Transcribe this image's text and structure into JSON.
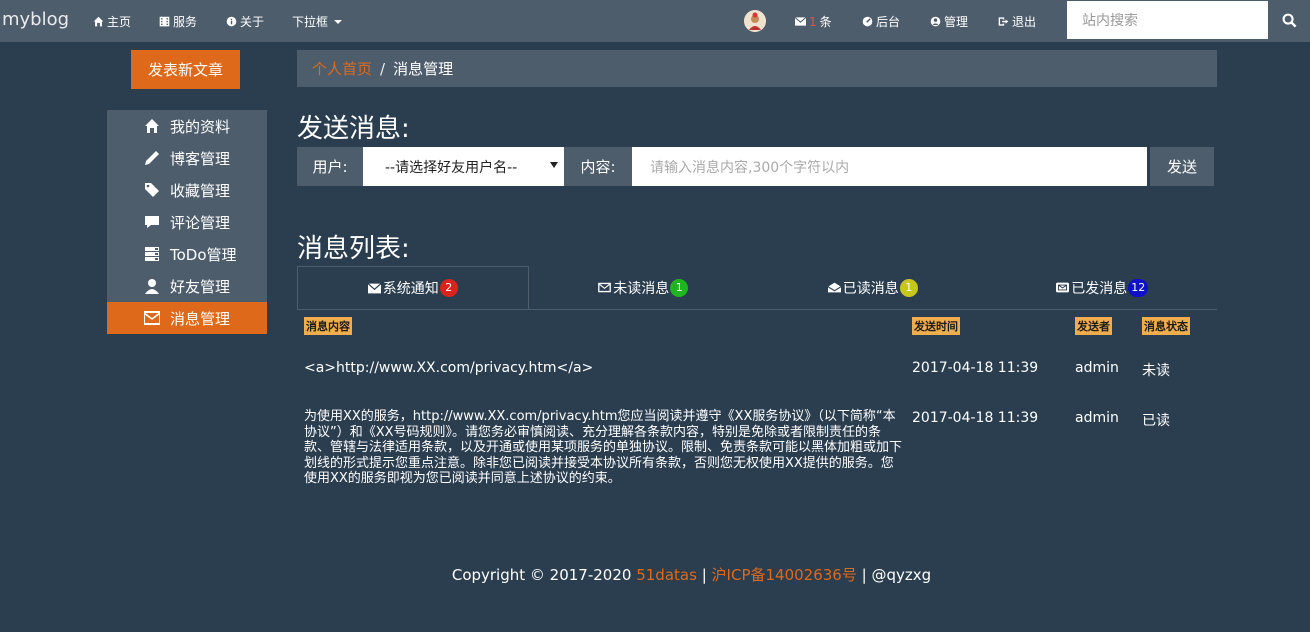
{
  "navbar": {
    "brand": "myblog",
    "items": [
      {
        "label": "主页",
        "icon": "home-icon"
      },
      {
        "label": "服务",
        "icon": "film-icon"
      },
      {
        "label": "关于",
        "icon": "info-icon"
      }
    ],
    "dropdown_label": "下拉框",
    "messages_count": "1",
    "messages_suffix": "条",
    "backend_label": "后台",
    "manage_label": "管理",
    "logout_label": "退出",
    "search_placeholder": "站内搜索"
  },
  "sidebar": {
    "new_post_label": "发表新文章",
    "items": [
      {
        "label": "我的资料",
        "icon": "home-icon"
      },
      {
        "label": "博客管理",
        "icon": "pencil-icon"
      },
      {
        "label": "收藏管理",
        "icon": "tags-icon"
      },
      {
        "label": "评论管理",
        "icon": "comment-icon"
      },
      {
        "label": "ToDo管理",
        "icon": "tasks-icon"
      },
      {
        "label": "好友管理",
        "icon": "user-icon"
      },
      {
        "label": "消息管理",
        "icon": "envelope-icon"
      }
    ]
  },
  "breadcrumb": {
    "home": "个人首页",
    "separator": "/",
    "current": "消息管理"
  },
  "send": {
    "title": "发送消息:",
    "user_label": "用户:",
    "user_select_value": "--请选择好友用户名--",
    "content_label": "内容:",
    "content_placeholder": "请输入消息内容,300个字符以内",
    "send_button": "发送"
  },
  "list": {
    "title": "消息列表:",
    "tabs": [
      {
        "label": "系统通知",
        "count": "2",
        "badge_color": "#d9231d"
      },
      {
        "label": "未读消息",
        "count": "1",
        "badge_color": "#1fb51f"
      },
      {
        "label": "已读消息",
        "count": "1",
        "badge_color": "#c7c71a"
      },
      {
        "label": "已发消息",
        "count": "12",
        "badge_color": "#1010c8"
      }
    ],
    "headers": {
      "content": "消息内容",
      "time": "发送时间",
      "sender": "发送者",
      "status": "消息状态"
    },
    "rows": [
      {
        "content": "<a>http://www.XX.com/privacy.htm</a>",
        "time": "2017-04-18 11:39",
        "sender": "admin",
        "status": "未读"
      },
      {
        "content": "为使用XX的服务，http://www.XX.com/privacy.htm您应当阅读并遵守《XX服务协议》（以下简称“本协议”）和《XX号码规则》。请您务必审慎阅读、充分理解各条款内容，特别是免除或者限制责任的条款、管辖与法律适用条款，以及开通或使用某项服务的单独协议。限制、免责条款可能以黑体加粗或加下划线的形式提示您重点注意。除非您已阅读并接受本协议所有条款，否则您无权使用XX提供的服务。您使用XX的服务即视为您已阅读并同意上述协议的约束。",
        "time": "2017-04-18 11:39",
        "sender": "admin",
        "status": "已读"
      }
    ]
  },
  "footer": {
    "copyright": "Copyright © 2017-2020",
    "link1": "51datas",
    "sep1": "|",
    "link2": "沪ICP备14002636号",
    "sep2": "|",
    "author": "@qyzxg"
  },
  "colors": {
    "bg": "#2b3e50",
    "panel": "#4e5d6c",
    "accent": "#df691a",
    "header_label": "#f0ad4e"
  }
}
